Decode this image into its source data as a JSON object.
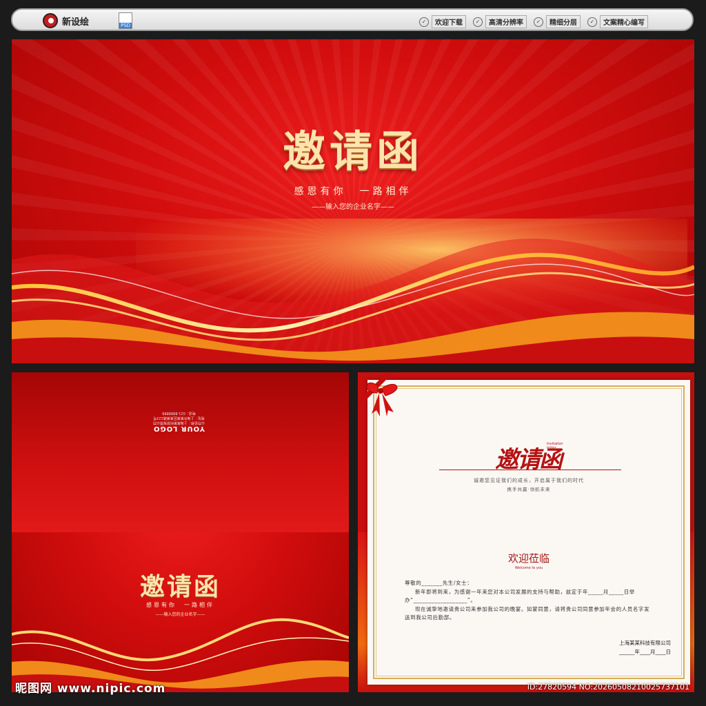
{
  "site": {
    "brand": "新设绘",
    "file_badge": "PSD",
    "features": [
      "欢迎下载",
      "高清分辨率",
      "精细分层",
      "文案精心编写"
    ]
  },
  "cover": {
    "title": "邀请函",
    "subtitle": "感恩有你　一路相伴",
    "company": "——输入您的企业名字——"
  },
  "back": {
    "logo": "YOUR LOGO",
    "logo_sub": [
      "公司名称：上海某某科技有限公司",
      "地址：上海市某某区某某路123号",
      "电话：021-8888888"
    ],
    "title": "邀请函",
    "subtitle": "感恩有你　一路相伴",
    "company": "——输入您的企业名字——"
  },
  "letter": {
    "heading": "邀请函",
    "heading_en": [
      "Invitation",
      "letter"
    ],
    "intro_line1": "诚邀您见证我们的成长，开启属于我们的时代",
    "intro_line2": "携手共赢·领航未来",
    "welcome": "欢迎莅临",
    "welcome_en": "Welcome to you",
    "greeting": "尊敬的_______先生/女士：",
    "para1": "新年即将到来，为感谢一年来您对本公司发展的支持与帮助，兹定于年_____月_____日举办“__________________”。",
    "para2": "现在诚挚地邀请贵公司来参加我公司的晚宴。如蒙同意，请将贵公司同意参加年会的人员名字发送到我公司后勤部。",
    "signature": "上海某某科技有限公司",
    "date": "______年____月____日"
  },
  "watermark": {
    "left": "昵图网 www.nipic.com",
    "right": "ID:27820594 NO:20260508210025737101"
  },
  "colors": {
    "red": "#d20d0d",
    "dark_red": "#a60404",
    "gold_text": "#ffe3ad",
    "frame_gold": "#d7ad5a"
  }
}
